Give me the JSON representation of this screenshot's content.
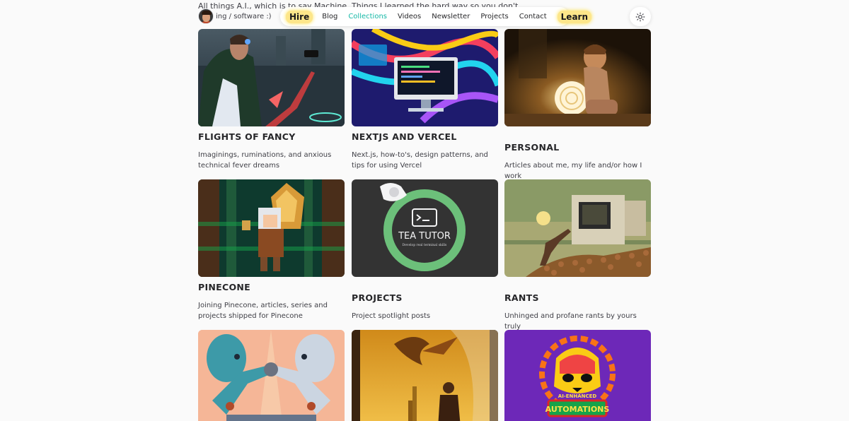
{
  "peek": {
    "left": "All things A.I., which is to say Machine",
    "middle": "Things I learned the hard way so you don't"
  },
  "avatar": {
    "caption": "ing / software :)"
  },
  "nav": {
    "hire": "Hire",
    "items": [
      "Blog",
      "Collections",
      "Videos",
      "Newsletter",
      "Projects",
      "Contact"
    ],
    "active_index": 1,
    "learn": "Learn"
  },
  "theme_toggle": {
    "icon": "sun-icon"
  },
  "colors": {
    "accent": "#14b8a6",
    "highlight": "#fde68a"
  },
  "collections": [
    {
      "title": "FLIGHTS OF FANCY",
      "description": "Imaginings, ruminations, and anxious technical fever dreams"
    },
    {
      "title": "NEXTJS AND VERCEL",
      "description": "Next.js, how-to's, design patterns, and tips for using Vercel"
    },
    {
      "title": "PERSONAL",
      "description": "Articles about me, my life and/or how I work"
    },
    {
      "title": "PINECONE",
      "description": "Joining Pinecone, articles, series and projects shipped for Pinecone"
    },
    {
      "title": "PROJECTS",
      "description": "Project spotlight posts",
      "image_text": "TEA TUTOR",
      "image_subtext": "Develop real terminal skills"
    },
    {
      "title": "RANTS",
      "description": "Unhinged and profane rants by yours truly"
    },
    {
      "title": "",
      "description": ""
    },
    {
      "title": "",
      "description": ""
    },
    {
      "title": "",
      "description": "",
      "image_text_top": "AI-ENHANCED",
      "image_text": "AUTOMATIONS"
    }
  ]
}
